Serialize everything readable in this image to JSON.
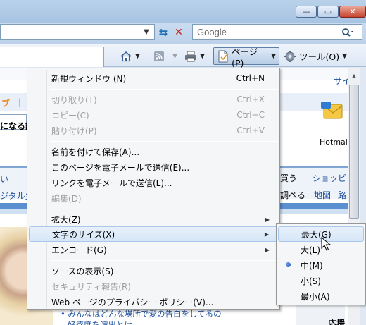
{
  "window": {
    "minimize": "—",
    "maximize": "▭",
    "close": "✕"
  },
  "address_bar": {
    "value": "",
    "dropdown_icon": "chevron-down-icon",
    "refresh_icon": "refresh-icon",
    "stop_icon": "stop-icon"
  },
  "search": {
    "placeholder": "Google",
    "button_icon": "search-icon"
  },
  "command_bar": {
    "home_icon": "home-icon",
    "feeds_icon": "rss-icon",
    "print_icon": "printer-icon",
    "page_label": "ページ(P)",
    "tools_label": "ツール(O)"
  },
  "page_behind": {
    "top_right_link": "サイ",
    "left_orange": "ブ",
    "left_text_1": "になる話",
    "hotmail": "Hotmail",
    "left_text_2": "い",
    "left_text_3": "ジタル生",
    "right_text_1": "買う",
    "right_text_2": "ショッピン",
    "right_text_3": "調べる",
    "right_text_4": "地図",
    "right_text_5": "路",
    "bottom_text_1": "みんなはどんな場所で愛の告白をしてるの",
    "bottom_text_2": "好感度を演出とは",
    "bottom_right": "応援"
  },
  "menu": {
    "items": [
      {
        "label": "新規ウィンドウ (N)",
        "shortcut": "Ctrl+N",
        "disabled": false
      },
      {
        "label": "切り取り(T)",
        "shortcut": "Ctrl+X",
        "disabled": true
      },
      {
        "label": "コピー(C)",
        "shortcut": "Ctrl+C",
        "disabled": true
      },
      {
        "label": "貼り付け(P)",
        "shortcut": "Ctrl+V",
        "disabled": true
      },
      {
        "label": "名前を付けて保存(A)...",
        "shortcut": "",
        "disabled": false
      },
      {
        "label": "このページを電子メールで送信(E)...",
        "shortcut": "",
        "disabled": false
      },
      {
        "label": "リンクを電子メールで送信(L)...",
        "shortcut": "",
        "disabled": false
      },
      {
        "label": "編集(D)",
        "shortcut": "",
        "disabled": true
      },
      {
        "label": "拡大(Z)",
        "shortcut": "",
        "disabled": false
      },
      {
        "label": "文字のサイズ(X)",
        "shortcut": "",
        "disabled": false
      },
      {
        "label": "エンコード(G)",
        "shortcut": "",
        "disabled": false
      },
      {
        "label": "ソースの表示(S)",
        "shortcut": "",
        "disabled": false
      },
      {
        "label": "セキュリティ報告(R)",
        "shortcut": "",
        "disabled": true
      },
      {
        "label": "Web ページのプライバシー ポリシー(V)...",
        "shortcut": "",
        "disabled": false
      }
    ]
  },
  "text_size_submenu": {
    "items": [
      {
        "label": "最大(G)"
      },
      {
        "label": "大(L)"
      },
      {
        "label": "中(M)"
      },
      {
        "label": "小(S)"
      },
      {
        "label": "最小(A)"
      }
    ],
    "selected": "中(M)",
    "hovered": "最大(G)"
  }
}
